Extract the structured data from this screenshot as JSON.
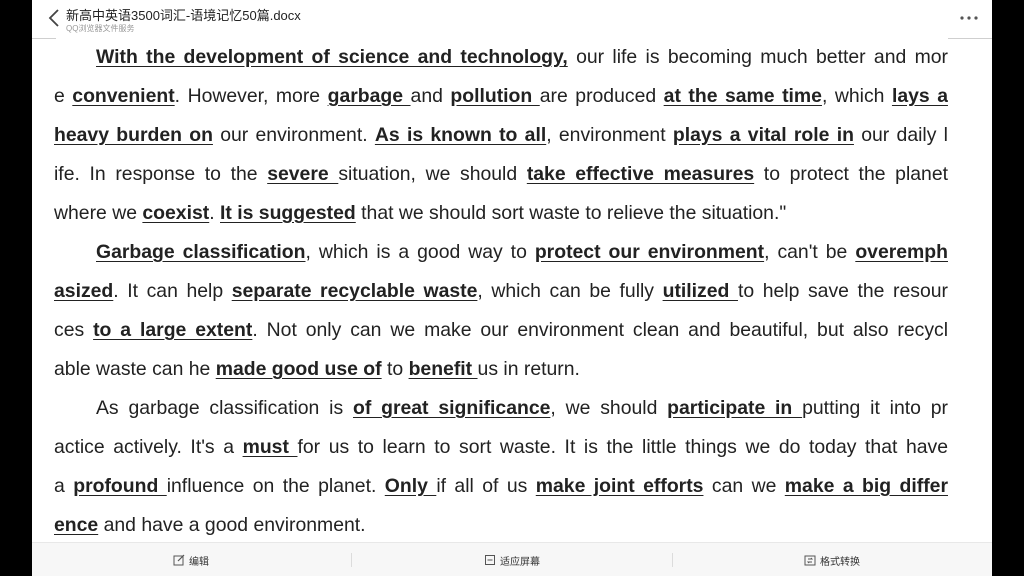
{
  "titlebar": {
    "title": "新高中英语3500词汇-语境记忆50篇.docx",
    "subtitle": "QQ浏览器文件服务"
  },
  "icons": {
    "back": "chevron-left-icon",
    "more": "more-horizontal-icon",
    "edit": "edit-icon",
    "fit": "fit-screen-icon",
    "convert": "format-convert-icon"
  },
  "document": {
    "paragraphs": [
      [
        [
          [
            "With the development of science and technology,",
            true
          ],
          [
            " our life is becoming much better and mor",
            false
          ]
        ],
        [
          [
            "e ",
            false
          ],
          [
            "convenient",
            true
          ],
          [
            ". However, more ",
            false
          ],
          [
            "garbage ",
            true
          ],
          [
            "and ",
            false
          ],
          [
            "pollution ",
            true
          ],
          [
            "are produced ",
            false
          ],
          [
            "at the same time",
            true
          ],
          [
            ", which ",
            false
          ],
          [
            "lays a",
            true
          ]
        ],
        [
          [
            "heavy burden on",
            true
          ],
          [
            " our environment. ",
            false
          ],
          [
            "As is known to all",
            true
          ],
          [
            ", environment ",
            false
          ],
          [
            "plays a vital role in",
            true
          ],
          [
            " our daily l",
            false
          ]
        ],
        [
          [
            "ife. In response to the ",
            false
          ],
          [
            "severe ",
            true
          ],
          [
            "situation, we should ",
            false
          ],
          [
            "take effective measures",
            true
          ],
          [
            " to protect the planet",
            false
          ]
        ],
        [
          [
            "where we ",
            false
          ],
          [
            "coexist",
            true
          ],
          [
            ". ",
            false
          ],
          [
            "It is suggested",
            true
          ],
          [
            " that we should sort waste to relieve the situation.\"",
            false
          ]
        ]
      ],
      [
        [
          [
            "Garbage classification",
            true
          ],
          [
            ", which is a good way to ",
            false
          ],
          [
            "protect our environment",
            true
          ],
          [
            ", can't be ",
            false
          ],
          [
            "overemph",
            true
          ]
        ],
        [
          [
            "asized",
            true
          ],
          [
            ". It can help ",
            false
          ],
          [
            "separate recyclable waste",
            true
          ],
          [
            ", which can be fully ",
            false
          ],
          [
            "utilized ",
            true
          ],
          [
            "to help save the resour",
            false
          ]
        ],
        [
          [
            "ces ",
            false
          ],
          [
            "to a large extent",
            true
          ],
          [
            ". Not only can we make our environment clean and beautiful, but also recycl",
            false
          ]
        ],
        [
          [
            "able waste can he ",
            false
          ],
          [
            "made good use of",
            true
          ],
          [
            " to ",
            false
          ],
          [
            "benefit ",
            true
          ],
          [
            "us in return.",
            false
          ]
        ]
      ],
      [
        [
          [
            "As garbage classification is ",
            false
          ],
          [
            "of great significance",
            true
          ],
          [
            ", we should ",
            false
          ],
          [
            "participate in ",
            true
          ],
          [
            "putting it into pr",
            false
          ]
        ],
        [
          [
            "actice actively. It's a ",
            false
          ],
          [
            "must ",
            true
          ],
          [
            "for us to learn to sort waste. It is the little things we do today that have",
            false
          ]
        ],
        [
          [
            "a ",
            false
          ],
          [
            "profound ",
            true
          ],
          [
            "influence on the planet. ",
            false
          ],
          [
            "Only ",
            true
          ],
          [
            "if all of us ",
            false
          ],
          [
            "make joint efforts",
            true
          ],
          [
            " can we ",
            false
          ],
          [
            "make a big differ",
            true
          ]
        ],
        [
          [
            "ence",
            true
          ],
          [
            " and have a good environment.",
            false
          ]
        ]
      ]
    ]
  },
  "toolbar": {
    "edit_label": "编辑",
    "fit_label": "适应屏幕",
    "convert_label": "格式转换"
  }
}
